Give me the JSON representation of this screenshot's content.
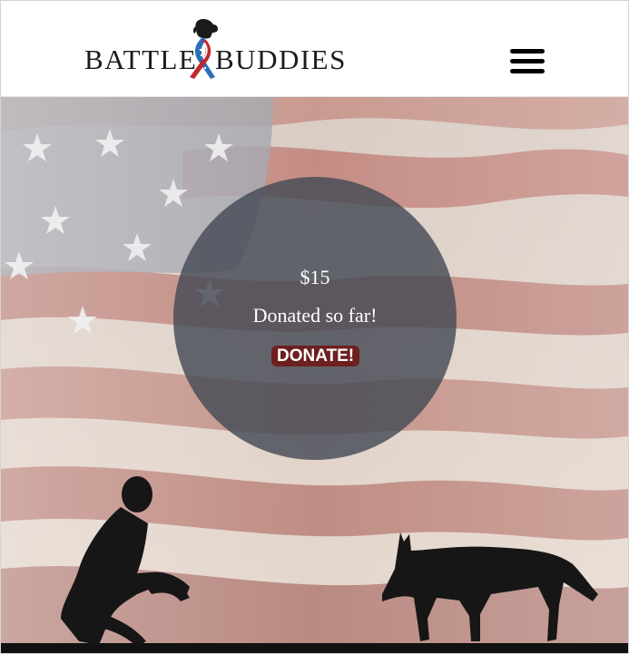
{
  "header": {
    "logo": {
      "word_left": "BATTLE",
      "word_right": "BUDDIES",
      "ribbon_icon": "dog-ribbon-icon"
    },
    "menu_icon": "hamburger-menu-icon"
  },
  "hero": {
    "background": "american-flag-with-soldier-and-dog-silhouette",
    "donation": {
      "amount": "$15",
      "label": "Donated so far!",
      "button_label": "DONATE!"
    }
  },
  "colors": {
    "donate_button": "#6e1f1f",
    "circle_overlay": "#464b55",
    "flag_stripe_red": "#c49088",
    "flag_stripe_white": "#e8ddd4",
    "flag_canton": "#a8a9b0"
  }
}
